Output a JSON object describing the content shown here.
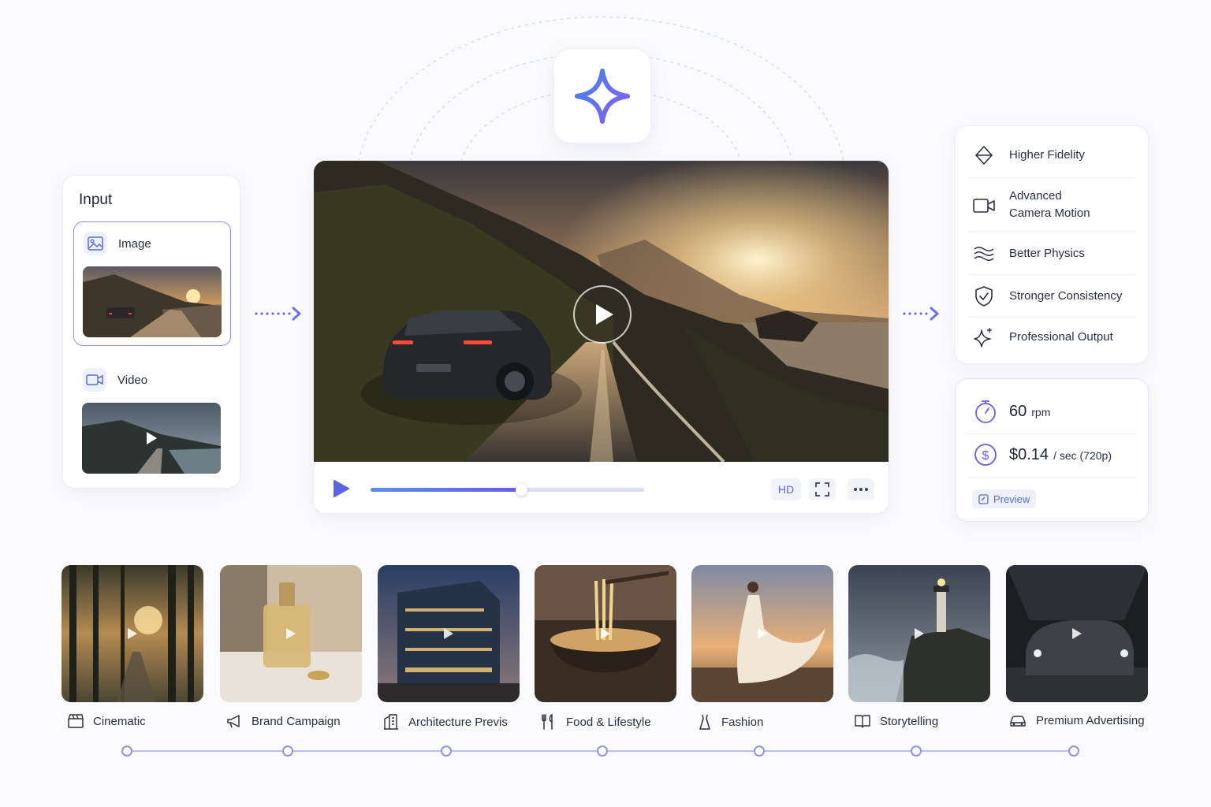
{
  "input": {
    "title": "Input",
    "options": [
      {
        "label": "Image",
        "icon": "image-icon",
        "selected": true
      },
      {
        "label": "Video",
        "icon": "video-icon",
        "selected": false
      }
    ]
  },
  "player": {
    "quality_label": "HD",
    "progress": 0.55,
    "icons": [
      "play-icon",
      "fullscreen-icon",
      "more-icon"
    ]
  },
  "features": [
    {
      "label": "Higher Fidelity",
      "icon": "diamond-icon"
    },
    {
      "label": "Advanced\nCamera Motion",
      "icon": "camera-icon"
    },
    {
      "label": "Better Physics",
      "icon": "waves-icon"
    },
    {
      "label": "Stronger Consistency",
      "icon": "shield-check-icon"
    },
    {
      "label": "Professional Output",
      "icon": "sparkle-icon"
    }
  ],
  "pricing": {
    "rate_value": "60",
    "rate_unit": "rpm",
    "price_value": "$0.14",
    "price_unit": "/ sec (720p)",
    "preview_label": "Preview"
  },
  "use_cases": [
    {
      "label": "Cinematic",
      "icon": "clapperboard-icon"
    },
    {
      "label": "Brand Campaign",
      "icon": "megaphone-icon"
    },
    {
      "label": "Architecture Previs",
      "icon": "building-icon"
    },
    {
      "label": "Food & Lifestyle",
      "icon": "utensils-icon"
    },
    {
      "label": "Fashion",
      "icon": "dress-icon"
    },
    {
      "label": "Storytelling",
      "icon": "book-icon"
    },
    {
      "label": "Premium Advertising",
      "icon": "car-icon"
    }
  ],
  "colors": {
    "accent": "#6a5cf0",
    "accent_light": "#8f8ff0",
    "text": "#2a2e45"
  }
}
